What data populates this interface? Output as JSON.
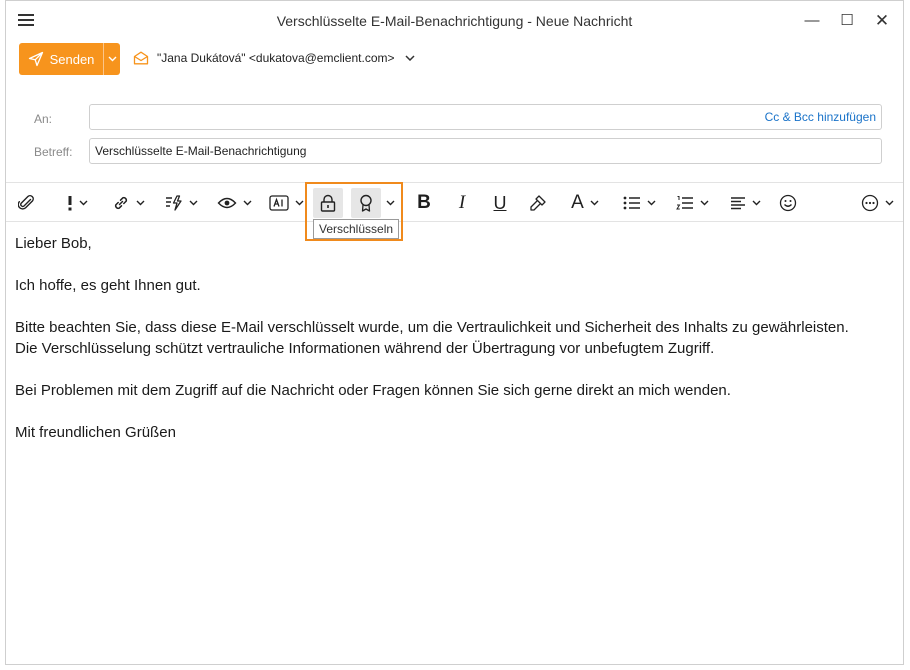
{
  "window": {
    "title": "Verschlüsselte E-Mail-Benachrichtigung - Neue Nachricht",
    "controls": {
      "minimize": "—",
      "maximize": "☐",
      "close": "✕"
    }
  },
  "send": {
    "label": "Senden"
  },
  "from": {
    "value": "\"Jana Dukátová\" <dukatova@emclient.com>"
  },
  "fields": {
    "to_label": "An:",
    "to_value": "",
    "cc_bcc": "Cc & Bcc hinzufügen",
    "subject_label": "Betreff:",
    "subject_value": "Verschlüsselte E-Mail-Benachrichtigung"
  },
  "toolbar": {
    "tooltip": "Verschlüsseln",
    "bold": "B",
    "italic": "I",
    "underline": "U",
    "font_color": "A",
    "icons": [
      "paperclip-icon",
      "priority-icon",
      "link-icon",
      "quick-text-icon",
      "visibility-icon",
      "ai-icon",
      "lock-icon",
      "certificate-icon",
      "bold-icon",
      "italic-icon",
      "underline-icon",
      "format-painter-icon",
      "font-color-icon",
      "bullet-list-icon",
      "numbered-list-icon",
      "align-icon",
      "emoji-icon",
      "more-icon"
    ]
  },
  "colors": {
    "accent": "#f7941d",
    "highlight": "#f08a1c",
    "link": "#1a73c9"
  },
  "body": {
    "greeting": "Lieber Bob,",
    "line1": "Ich hoffe, es geht Ihnen gut.",
    "line2": "Bitte beachten Sie, dass diese E-Mail verschlüsselt wurde, um die Vertraulichkeit und Sicherheit des Inhalts zu gewährleisten.",
    "line3": "Die Verschlüsselung schützt vertrauliche Informationen während der Übertragung vor unbefugtem Zugriff.",
    "line4": "Bei Problemen mit dem Zugriff auf die Nachricht oder Fragen können Sie sich gerne direkt an mich wenden.",
    "closing": "Mit freundlichen Grüßen"
  }
}
